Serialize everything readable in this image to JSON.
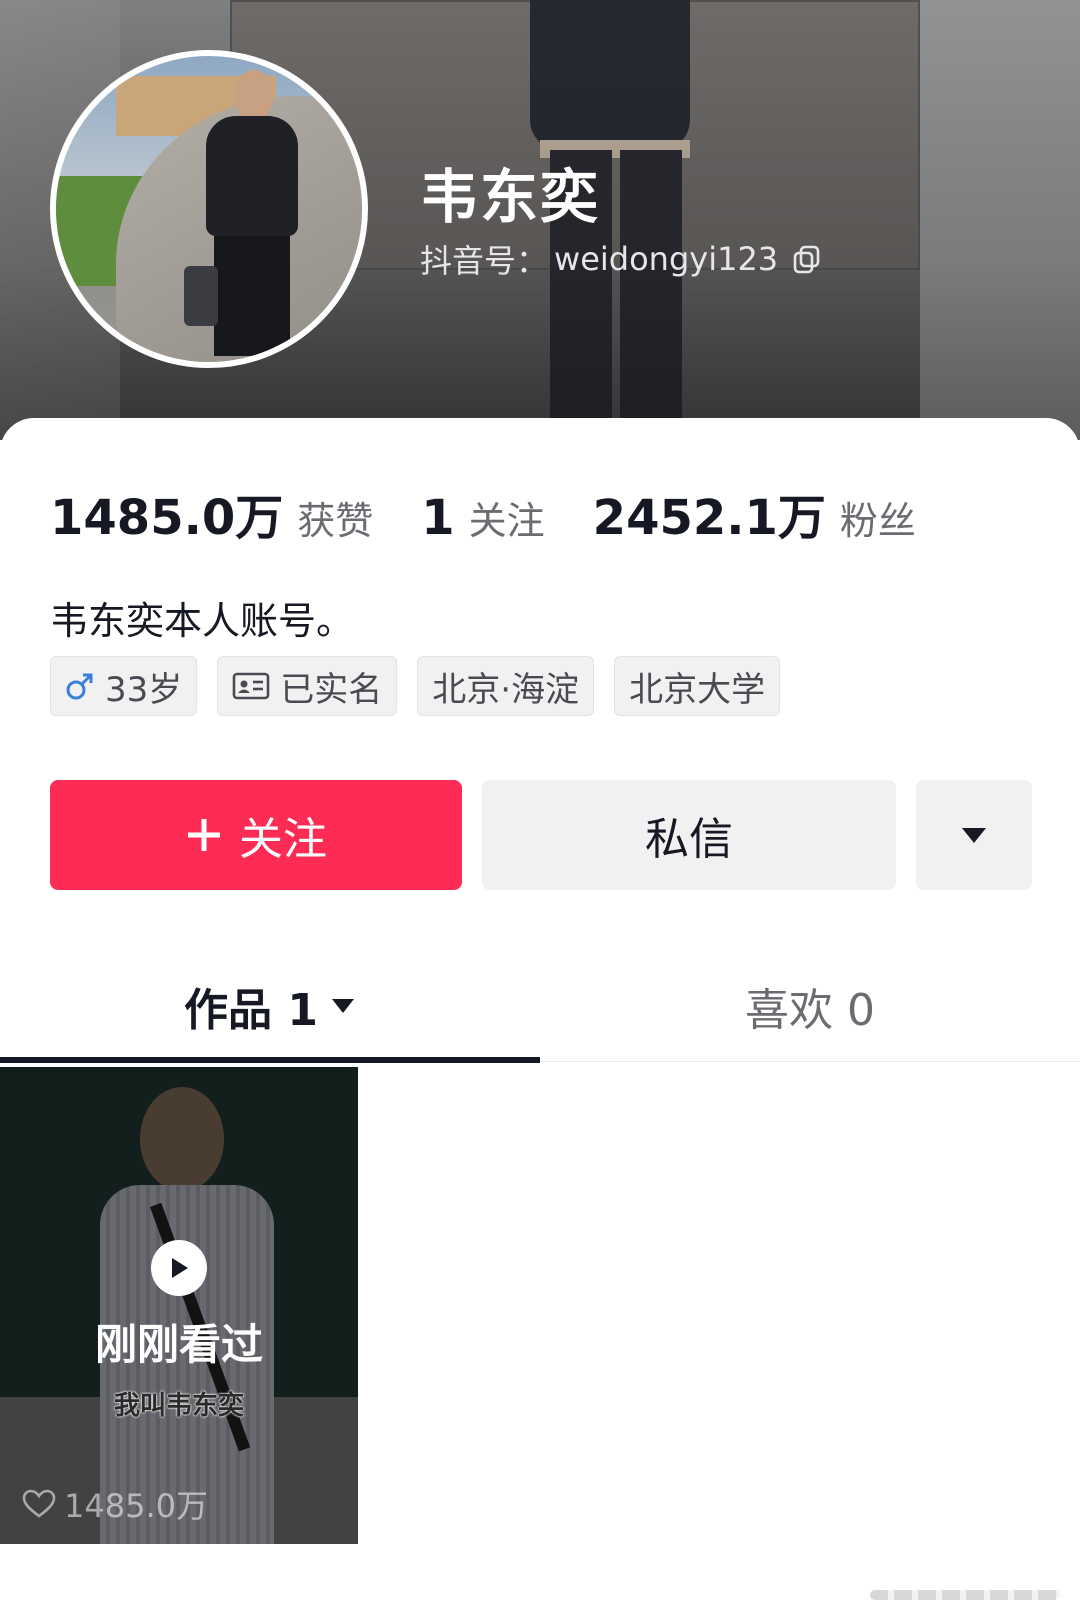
{
  "profile": {
    "name": "韦东奕",
    "douyin_id_label": "抖音号：",
    "douyin_id": "weidongyi123"
  },
  "stats": [
    {
      "value": "1485.0万",
      "label": "获赞"
    },
    {
      "value": "1",
      "label": "关注"
    },
    {
      "value": "2452.1万",
      "label": "粉丝"
    }
  ],
  "bio": "韦东奕本人账号。",
  "tags": [
    {
      "icon": "male-icon",
      "text": "33岁"
    },
    {
      "icon": "id-card-icon",
      "text": "已实名"
    },
    {
      "icon": "",
      "text": "北京·海淀"
    },
    {
      "icon": "",
      "text": "北京大学"
    }
  ],
  "actions": {
    "follow_label": "关注",
    "message_label": "私信",
    "more_icon": "caret-down-icon"
  },
  "tabs": [
    {
      "label": "作品 1",
      "active": true
    },
    {
      "label": "喜欢 0",
      "active": false
    }
  ],
  "videos": [
    {
      "overlay": "刚刚看过",
      "caption": "我叫韦东奕",
      "likes": "1485.0万"
    }
  ],
  "colors": {
    "accent": "#fe2c55",
    "text_primary": "#161823",
    "text_secondary": "#6b6c72",
    "tag_bg": "#f1f1f2",
    "male_icon": "#3a80d9"
  }
}
